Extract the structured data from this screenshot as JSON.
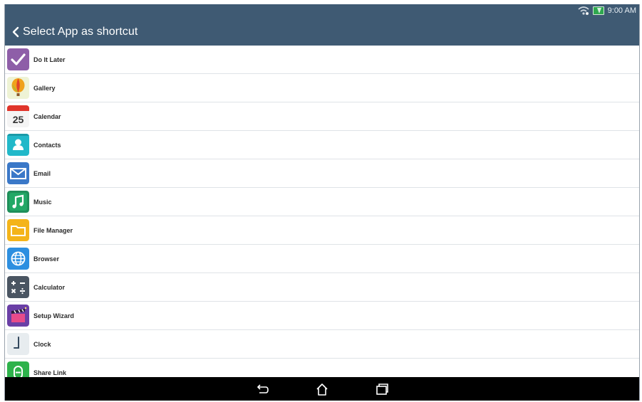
{
  "status_bar": {
    "time": "9:00 AM",
    "wifi_icon": "wifi-icon",
    "battery_icon": "battery-charging-icon"
  },
  "header": {
    "title": "Select App as shortcut",
    "back_icon": "back-chevron-icon"
  },
  "apps": [
    {
      "label": "Do It Later",
      "icon": "checkmark-icon",
      "color": "#8e5ea8"
    },
    {
      "label": "Gallery",
      "icon": "balloon-icon",
      "color": "#e9f0c8"
    },
    {
      "label": "Calendar",
      "icon": "calendar-icon",
      "day": "25",
      "color": "#e0352b"
    },
    {
      "label": "Contacts",
      "icon": "person-icon",
      "color": "#21b8c9"
    },
    {
      "label": "Email",
      "icon": "envelope-icon",
      "color": "#3a78c8"
    },
    {
      "label": "Music",
      "icon": "music-note-icon",
      "color": "#1f8f5a"
    },
    {
      "label": "File Manager",
      "icon": "folder-icon",
      "color": "#f4b41a"
    },
    {
      "label": "Browser",
      "icon": "globe-icon",
      "color": "#2d8fe0"
    },
    {
      "label": "Calculator",
      "icon": "calculator-icon",
      "color": "#4a5562"
    },
    {
      "label": "Setup Wizard",
      "icon": "clapper-icon",
      "color": "#6a3fa6"
    },
    {
      "label": "Clock",
      "icon": "clock-icon",
      "color": "#e7ecef"
    },
    {
      "label": "Share Link",
      "icon": "share-link-icon",
      "color": "#2eb24b"
    }
  ],
  "nav_bar": {
    "back_icon": "nav-back-icon",
    "home_icon": "nav-home-icon",
    "recents_icon": "nav-recents-icon"
  }
}
